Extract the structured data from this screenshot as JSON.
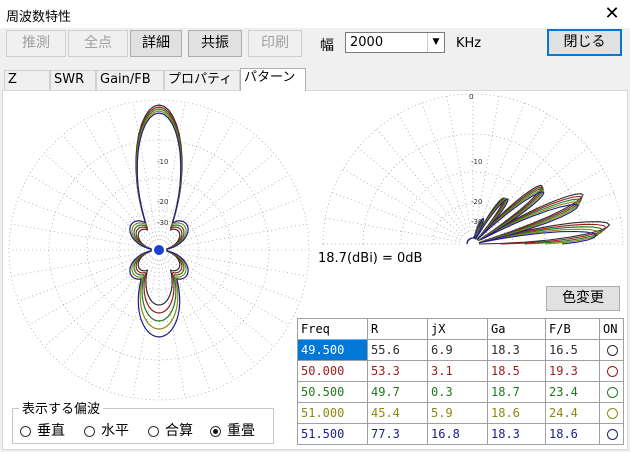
{
  "window": {
    "title": "周波数特性",
    "close_glyph": "✕"
  },
  "toolbar": {
    "buttons": [
      {
        "label": "推測",
        "enabled": false
      },
      {
        "label": "全点",
        "enabled": false
      },
      {
        "label": "詳細",
        "enabled": true
      },
      {
        "label": "共振",
        "enabled": true
      },
      {
        "label": "印刷",
        "enabled": false
      }
    ],
    "width_label": "幅",
    "width_value": "2000",
    "unit": "KHz",
    "close_button": "閉じる"
  },
  "tabs": [
    {
      "label": "Z"
    },
    {
      "label": "SWR"
    },
    {
      "label": "Gain/FB"
    },
    {
      "label": "プロパティ"
    },
    {
      "label": "パターン"
    }
  ],
  "polar_plot": {
    "ring_labels": [
      "-10",
      "-20",
      "-30"
    ],
    "top_label": "0"
  },
  "gain_reference": "18.7(dBi) = 0dB",
  "color_button": "色変更",
  "table": {
    "headers": [
      "Freq",
      "R",
      "jX",
      "Ga",
      "F/B",
      "ON"
    ],
    "rows": [
      {
        "freq": "49.500",
        "r": "55.6",
        "jx": "6.9",
        "ga": "18.3",
        "fb": "16.5",
        "color": "#2c2c2c"
      },
      {
        "freq": "50.000",
        "r": "53.3",
        "jx": "3.1",
        "ga": "18.5",
        "fb": "19.3",
        "color": "#9b1c1c"
      },
      {
        "freq": "50.500",
        "r": "49.7",
        "jx": "0.3",
        "ga": "18.7",
        "fb": "23.4",
        "color": "#1f7a1f"
      },
      {
        "freq": "51.000",
        "r": "45.4",
        "jx": "5.9",
        "ga": "18.6",
        "fb": "24.4",
        "color": "#8a8a14"
      },
      {
        "freq": "51.500",
        "r": "77.3",
        "jx": "16.8",
        "ga": "18.3",
        "fb": "18.6",
        "color": "#1c1c8a"
      }
    ]
  },
  "polarization": {
    "title": "表示する偏波",
    "options": [
      "垂直",
      "水平",
      "合算",
      "重畳"
    ],
    "selected": "重畳"
  }
}
